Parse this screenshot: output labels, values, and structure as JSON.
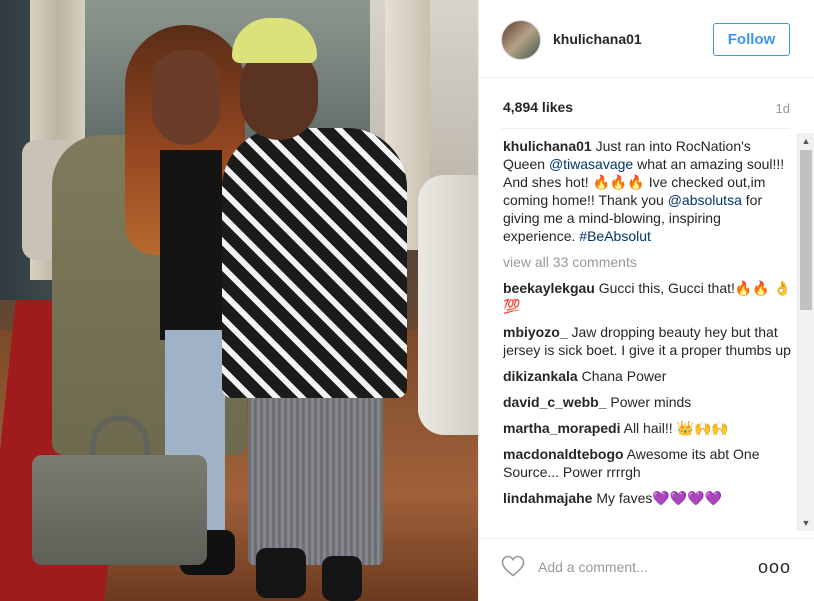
{
  "header": {
    "username": "khulichana01",
    "follow_label": "Follow"
  },
  "meta": {
    "likes": "4,894 likes",
    "time": "1d"
  },
  "caption": {
    "user": "khulichana01",
    "text_1": " Just ran into RocNation's Queen ",
    "mention_1": "@tiwasavage",
    "text_2": " what an amazing soul!!! And shes hot! 🔥🔥🔥 Ive checked out,im coming home!! Thank you ",
    "mention_2": "@absolutsa",
    "text_3": " for giving me a mind-blowing, inspiring experience. ",
    "hashtag": "#BeAbsolut"
  },
  "view_all": "view all 33 comments",
  "comments": [
    {
      "user": "beekaylekgau",
      "text": " Gucci this, Gucci that!🔥🔥 👌💯"
    },
    {
      "user": "mbiyozo_",
      "text": " Jaw dropping beauty hey but that jersey is sick boet. I give it a proper thumbs up"
    },
    {
      "user": "dikizankala",
      "text": " Chana Power"
    },
    {
      "user": "david_c_webb_",
      "text": " Power minds"
    },
    {
      "user": "martha_morapedi",
      "text": " All hail!! 👑🙌🙌"
    },
    {
      "user": "macdonaldtebogo",
      "text": " Awesome its abt One Source... Power rrrrgh"
    },
    {
      "user": "lindahmajahe",
      "text": " My faves💜💜💜💜"
    }
  ],
  "footer": {
    "add_comment_placeholder": "Add a comment...",
    "more_label": "ooo"
  },
  "icons": {
    "heart": "heart-icon",
    "more": "more-options-icon"
  },
  "colors": {
    "accent": "#3897f0",
    "link": "#003569",
    "muted": "#999999"
  }
}
